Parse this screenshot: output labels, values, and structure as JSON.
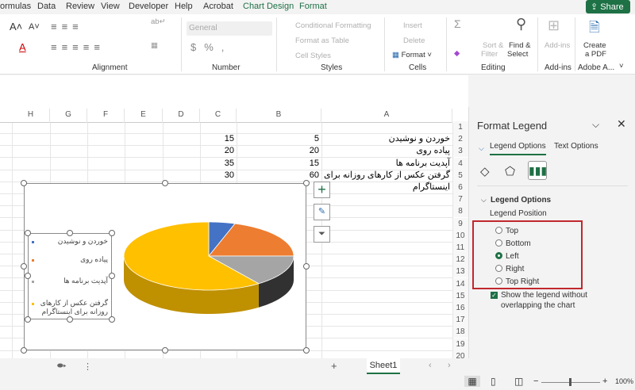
{
  "menu_tabs": [
    "ormulas",
    "Data",
    "Review",
    "View",
    "Developer",
    "Help",
    "Acrobat",
    "Chart Design",
    "Format"
  ],
  "share_label": "Share",
  "ribbon": {
    "groups": {
      "alignment": "Alignment",
      "number": "Number",
      "styles": "Styles",
      "cells": "Cells",
      "editing": "Editing",
      "addins": "Add-ins",
      "adobe": "Adobe A..."
    },
    "number_format": "General",
    "conditional_formatting": "Conditional Formatting",
    "format_as_table": "Format as Table",
    "cell_styles": "Cell Styles",
    "insert": "Insert",
    "delete": "Delete",
    "format": "Format",
    "sort_filter": [
      "Sort &",
      "Filter"
    ],
    "find_select": [
      "Find &",
      "Select"
    ],
    "addins_btn": "Add-ins",
    "create_pdf": [
      "Create",
      "a PDF"
    ]
  },
  "columns": [
    "H",
    "G",
    "F",
    "E",
    "D",
    "C",
    "B",
    "A"
  ],
  "rows": [
    "1",
    "2",
    "3",
    "4",
    "5",
    "6",
    "7",
    "8",
    "9",
    "10",
    "11",
    "12",
    "13",
    "14",
    "15",
    "16",
    "17",
    "18",
    "19",
    "20"
  ],
  "table": [
    {
      "a": "خوردن و نوشیدن",
      "b": "5",
      "c": "15"
    },
    {
      "a": "پیاده روی",
      "b": "20",
      "c": "20"
    },
    {
      "a": "آپدیت برنامه ها",
      "b": "15",
      "c": "35"
    },
    {
      "a": "گرفتن عکس از کارهای روزانه برای اینستاگرام",
      "b": "60",
      "c": "30"
    }
  ],
  "chart_data": {
    "type": "pie",
    "style": "3d",
    "categories": [
      "خوردن و نوشیدن",
      "پیاده روی",
      "آپدیت برنامه ها",
      "گرفتن عکس از کارهای روزانه برای اینستاگرام"
    ],
    "values": [
      5,
      20,
      15,
      60
    ],
    "colors": [
      "#4472c4",
      "#ed7d31",
      "#a5a5a5",
      "#ffc000"
    ],
    "legend_position": "left"
  },
  "panel": {
    "title": "Format Legend",
    "tab_legend": "Legend Options",
    "tab_text": "Text Options",
    "section": "Legend Options",
    "position_label": "Legend Position",
    "options": [
      "Top",
      "Bottom",
      "Left",
      "Right",
      "Top Right"
    ],
    "selected": "Left",
    "checkbox_label": [
      "Show the legend without",
      "overlapping the chart"
    ],
    "checkbox_checked": true
  },
  "sheet_tab": "Sheet1",
  "zoom": "100%"
}
